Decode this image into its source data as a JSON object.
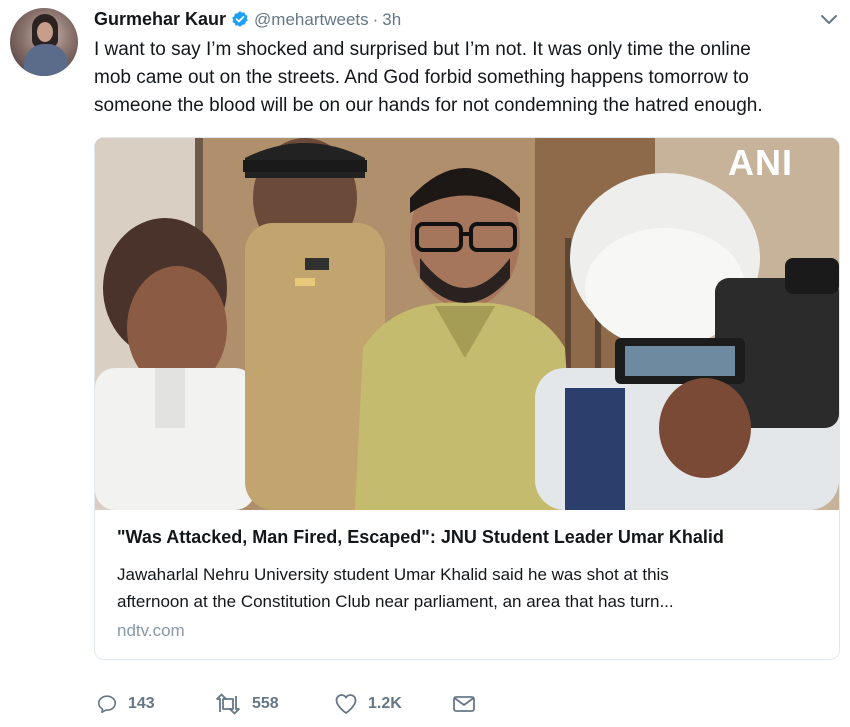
{
  "tweet": {
    "author_name": "Gurmehar Kaur",
    "handle": "@mehartweets",
    "separator": "·",
    "time": "3h",
    "text_lines": [
      "I want to say I’m shocked and surprised but I’m not. It was only time the online",
      "mob came out on the streets. And God forbid something happens tomorrow to",
      "someone the blood will be on our hands for not condemning the hatred enough."
    ]
  },
  "card": {
    "image_watermark": "ANI",
    "title": "\"Was Attacked, Man Fired, Escaped\": JNU Student Leader Umar Khalid",
    "description_lines": [
      "Jawaharlal Nehru University student Umar Khalid said he was shot at this",
      "afternoon at the Constitution Club near parliament, an area that has turn..."
    ],
    "domain": "ndtv.com"
  },
  "actions": {
    "replies": "143",
    "retweets": "558",
    "likes": "1.2K"
  },
  "icons": {
    "verified": "verified-badge-icon",
    "caret": "chevron-down-icon",
    "reply": "reply-icon",
    "retweet": "retweet-icon",
    "like": "heart-icon",
    "dm": "envelope-icon"
  },
  "colors": {
    "verified": "#1da1f2",
    "icon_gray": "#657786"
  }
}
